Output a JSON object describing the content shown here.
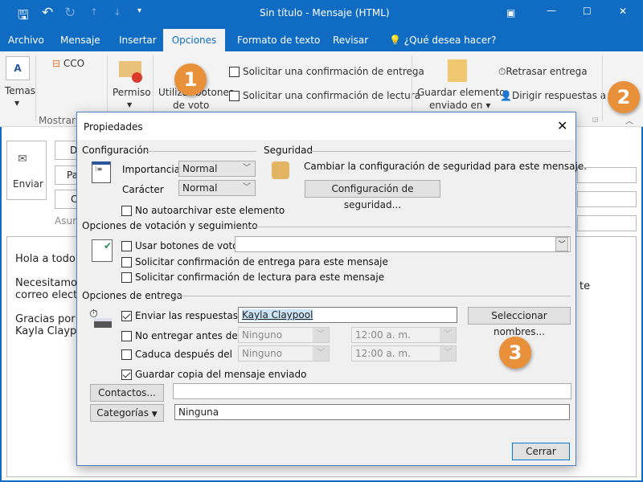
{
  "window": {
    "title": "Sin título  -  Mensaje (HTML)"
  },
  "tabs": [
    "Archivo",
    "Mensaje",
    "Insertar",
    "Opciones",
    "Formato de texto",
    "Revisar"
  ],
  "tell_me": "¿Qué desea hacer?",
  "ribbon": {
    "temas": "Temas",
    "cco": "CCO",
    "mostrar": "Mostrar c",
    "permiso": "Permiso",
    "voting_line1": "Utilizar botones",
    "voting_line2": "de voto",
    "req_delivery": "Solicitar una confirmación de entrega",
    "req_read": "Solicitar una confirmación de lectura",
    "save_line1": "Guardar elemento",
    "save_line2": "enviado en",
    "delay": "Retrasar entrega",
    "direct": "Dirigir respuestas a"
  },
  "compose": {
    "send": "Enviar",
    "from": "D",
    "to": "Pa",
    "cc": "C",
    "subject": "Asun",
    "body": [
      "Hola a todo",
      "Necesitamo",
      "correo elect",
      "Gracias por",
      "Kayla Claypo"
    ],
    "body_tail": "te"
  },
  "callouts": [
    "1",
    "2",
    "3"
  ],
  "dialog": {
    "title": "Propiedades",
    "config": {
      "heading": "Configuración",
      "importance_label": "Importancia",
      "importance": "Normal",
      "sensitivity_label": "Carácter",
      "sensitivity": "Normal",
      "no_autoarchive": "No autoarchivar este elemento"
    },
    "security": {
      "heading": "Seguridad",
      "text": "Cambiar la configuración de seguridad para este mensaje.",
      "button": "Configuración de seguridad..."
    },
    "voting": {
      "heading": "Opciones de votación y seguimiento",
      "use_voting": "Usar botones de voto",
      "voting_value": "",
      "req_delivery": "Solicitar confirmación de entrega para este mensaje",
      "req_read": "Solicitar confirmación de lectura para este mensaje"
    },
    "delivery": {
      "heading": "Opciones de entrega",
      "replies_to": "Enviar las respuestas a",
      "replies_value": "Kayla Claypool",
      "select_names": "Seleccionar nombres...",
      "not_before": "No entregar antes del",
      "not_before_date": "Ninguno",
      "not_before_time": "12:00 a. m.",
      "expires": "Caduca después del",
      "expires_date": "Ninguno",
      "expires_time": "12:00 a. m.",
      "save_copy": "Guardar copia del mensaje enviado"
    },
    "contacts": "Contactos...",
    "contacts_value": "",
    "categories": "Categorías",
    "categories_value": "Ninguna",
    "close": "Cerrar"
  },
  "state": {
    "replies_checked": true,
    "save_copy_checked": true
  }
}
